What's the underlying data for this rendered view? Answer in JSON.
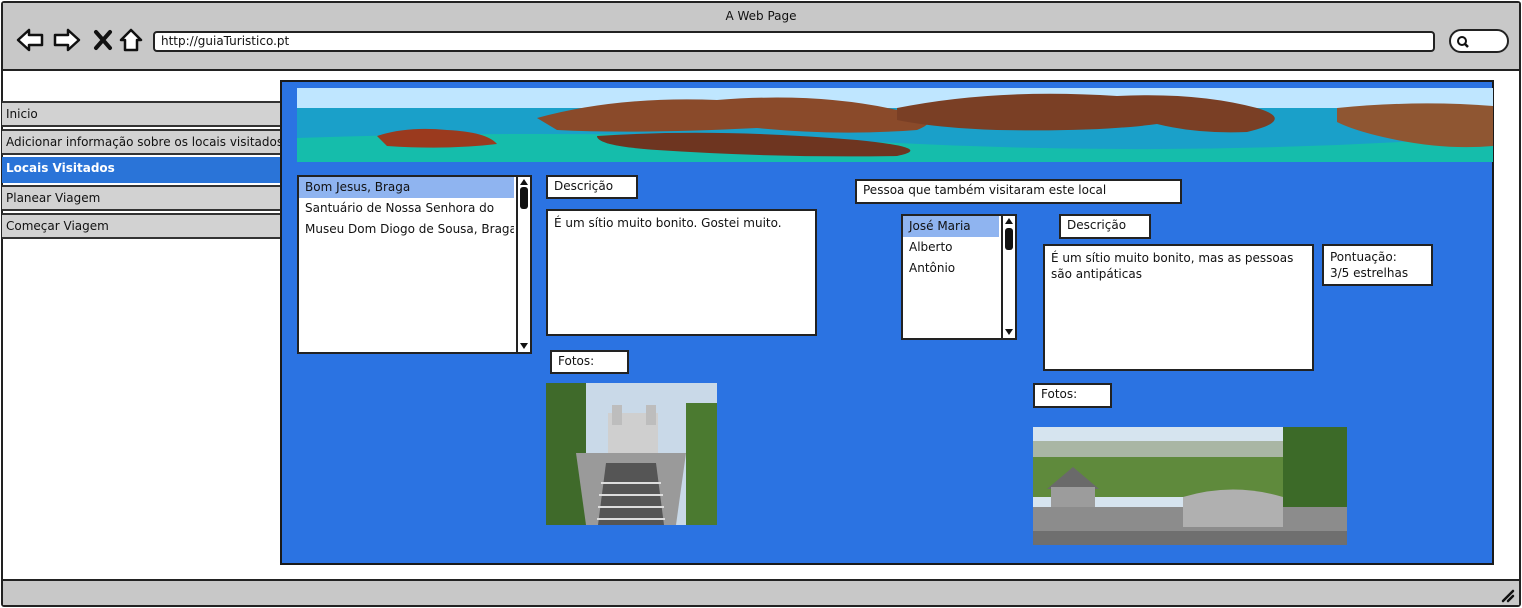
{
  "window": {
    "title": "A Web Page"
  },
  "browser": {
    "url": "http://guiaTuristico.pt",
    "back_icon": "back-arrow-icon",
    "forward_icon": "forward-arrow-icon",
    "close_icon": "close-icon",
    "home_icon": "home-icon",
    "search_icon": "search-icon"
  },
  "sidebar": {
    "items": [
      {
        "label": "Inicio",
        "active": false
      },
      {
        "label": "Adicionar informação sobre os locais visitados",
        "active": false
      },
      {
        "label": "Locais Visitados",
        "active": true
      },
      {
        "label": "Planear Viagem",
        "active": false
      },
      {
        "label": "Começar Viagem",
        "active": false
      }
    ]
  },
  "places": {
    "items": [
      "Bom Jesus, Braga",
      "Santuário de Nossa Senhora do",
      "Museu Dom Diogo de Sousa, Braga"
    ],
    "selected": 0
  },
  "description": {
    "label": "Descrição",
    "text": "É um sítio muito bonito. Gostei muito."
  },
  "photos": {
    "label": "Fotos:"
  },
  "others": {
    "label": "Pessoa que também visitaram este local",
    "people": [
      "José Maria",
      "Alberto",
      "Antônio"
    ],
    "selected": 0,
    "description_label": "Descrição",
    "description_text": "É um sítio muito bonito, mas as pessoas são antipáticas",
    "rating_label": "Pontuação:",
    "rating_value": "3/5 estrelhas",
    "photos_label": "Fotos:"
  },
  "colors": {
    "accent": "#2b73e2",
    "chrome": "#c8c8c8",
    "selected": "#8fb4f0"
  }
}
